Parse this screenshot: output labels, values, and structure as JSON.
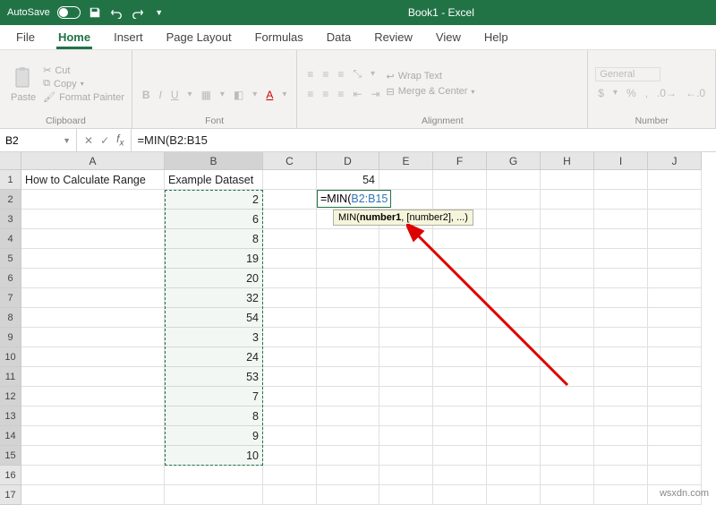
{
  "titlebar": {
    "autosave_label": "AutoSave",
    "title": "Book1 - Excel"
  },
  "menu": {
    "file": "File",
    "home": "Home",
    "insert": "Insert",
    "page_layout": "Page Layout",
    "formulas": "Formulas",
    "data": "Data",
    "review": "Review",
    "view": "View",
    "help": "Help"
  },
  "ribbon": {
    "clipboard": {
      "label": "Clipboard",
      "paste": "Paste",
      "cut": "Cut",
      "copy": "Copy",
      "fmt": "Format Painter"
    },
    "font": {
      "label": "Font"
    },
    "alignment": {
      "label": "Alignment",
      "wrap": "Wrap Text",
      "merge": "Merge & Center"
    },
    "number": {
      "label": "Number",
      "general": "General"
    }
  },
  "namebox": {
    "ref": "B2"
  },
  "formula_bar": {
    "formula": "=MIN(B2:B15"
  },
  "columns": [
    "A",
    "B",
    "C",
    "D",
    "E",
    "F",
    "G",
    "H",
    "I",
    "J"
  ],
  "rows": [
    1,
    2,
    3,
    4,
    5,
    6,
    7,
    8,
    9,
    10,
    11,
    12,
    13,
    14,
    15,
    16,
    17
  ],
  "cells": {
    "A1": "How to Calculate Range",
    "B1": "Example Dataset",
    "B2": "2",
    "B3": "6",
    "B4": "8",
    "B5": "19",
    "B6": "20",
    "B7": "32",
    "B8": "54",
    "B9": "3",
    "B10": "24",
    "B11": "53",
    "B12": "7",
    "B13": "8",
    "B14": "9",
    "B15": "10",
    "D1": "54"
  },
  "editing": {
    "prefix": "=MIN(",
    "ref": "B2:B15"
  },
  "tooltip": {
    "text_prefix": "MIN(",
    "bold": "number1",
    "rest": ", [number2], ...)"
  },
  "selection": {
    "col": "B",
    "row_start": 2,
    "row_end": 15
  },
  "watermark": "wsxdn.com"
}
